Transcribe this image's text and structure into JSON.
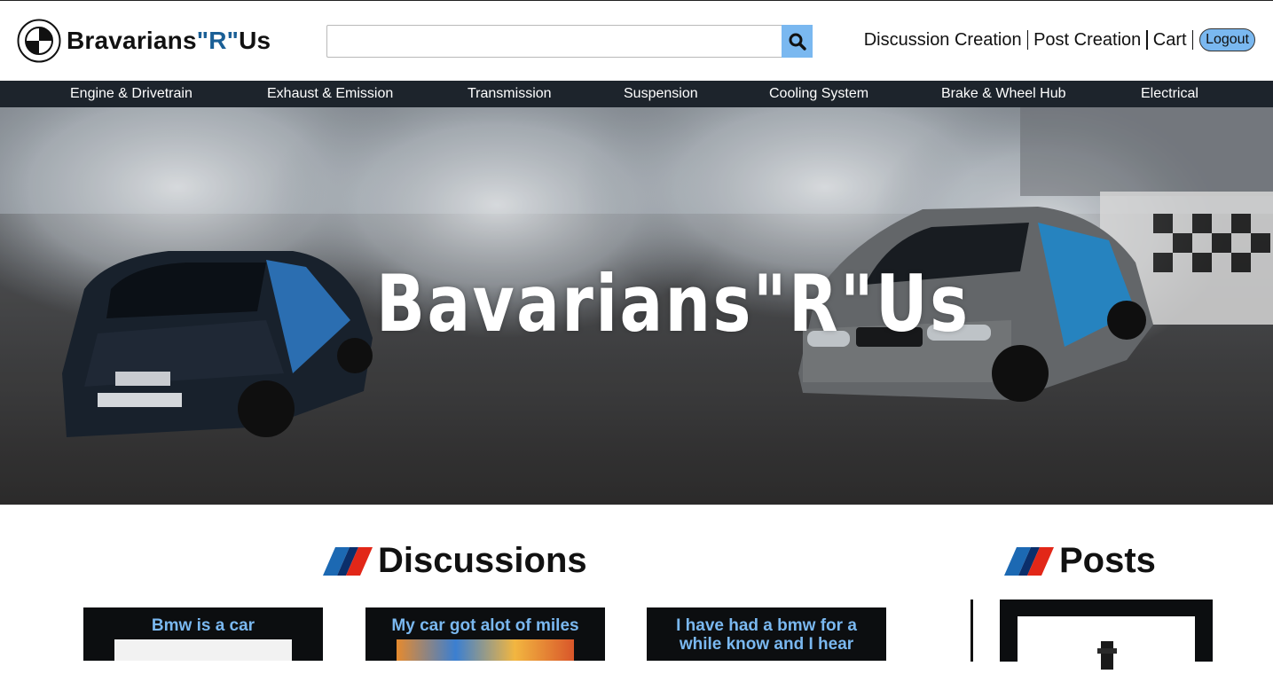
{
  "brand": {
    "part1": "Bravarians",
    "part2": "\"R\"",
    "part3": "Us"
  },
  "search": {
    "placeholder": "",
    "value": ""
  },
  "nav": {
    "discussion_creation": "Discussion Creation",
    "post_creation": "Post Creation",
    "cart": "Cart",
    "logout": "Logout"
  },
  "categories": [
    "Engine & Drivetrain",
    "Exhaust & Emission",
    "Transmission",
    "Suspension",
    "Cooling System",
    "Brake & Wheel Hub",
    "Electrical"
  ],
  "hero": {
    "title": "Bavarians\"R\"Us"
  },
  "discussions": {
    "title": "Discussions",
    "cards": [
      {
        "title": "Bmw is a car"
      },
      {
        "title": "My car got alot of miles"
      },
      {
        "title": "I have had a bmw for a while know and I hear"
      }
    ]
  },
  "posts": {
    "title": "Posts"
  },
  "colors": {
    "accent": "#7ab8f0",
    "brand_blue": "#1a5f96",
    "catbar": "#1d242c",
    "card_bg": "#0c0e10"
  }
}
